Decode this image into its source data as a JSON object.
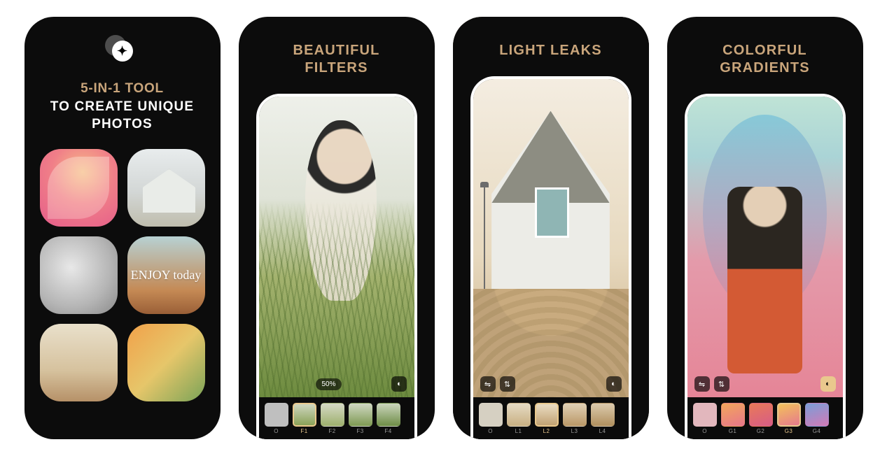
{
  "panel1": {
    "title_line1": "5-IN-1 TOOL",
    "title_line2": "TO CREATE UNIQUE",
    "title_line3": "PHOTOS",
    "tile_enjoy_text": "ENJOY today"
  },
  "panel2": {
    "heading_l1": "BEAUTIFUL",
    "heading_l2": "FILTERS",
    "intensity_label": "50%",
    "thumbs": [
      {
        "label": "O",
        "class": "tv-original",
        "selected": false
      },
      {
        "label": "F1",
        "class": "tv-f1",
        "selected": true
      },
      {
        "label": "F2",
        "class": "tv-f2",
        "selected": false
      },
      {
        "label": "F3",
        "class": "tv-f3",
        "selected": false
      },
      {
        "label": "F4",
        "class": "tv-f4",
        "selected": false
      }
    ]
  },
  "panel3": {
    "heading": "LIGHT LEAKS",
    "thumbs": [
      {
        "label": "O",
        "class": "tv-h0",
        "selected": false
      },
      {
        "label": "L1",
        "class": "tv-h1",
        "selected": false
      },
      {
        "label": "L2",
        "class": "tv-h2",
        "selected": true
      },
      {
        "label": "L3",
        "class": "tv-h3",
        "selected": false
      },
      {
        "label": "L4",
        "class": "tv-h4",
        "selected": false
      }
    ]
  },
  "panel4": {
    "heading_l1": "COLORFUL",
    "heading_l2": "GRADIENTS",
    "thumbs": [
      {
        "label": "O",
        "class": "tv-g0",
        "selected": false
      },
      {
        "label": "G1",
        "class": "tv-g1",
        "selected": false
      },
      {
        "label": "G2",
        "class": "tv-g2",
        "selected": false
      },
      {
        "label": "G3",
        "class": "tv-g3",
        "selected": true
      },
      {
        "label": "G4",
        "class": "tv-g4",
        "selected": false
      }
    ]
  },
  "icons": {
    "compare": "◐",
    "flip_h": "⇋",
    "flip_v": "⇅",
    "plus": "✦"
  }
}
